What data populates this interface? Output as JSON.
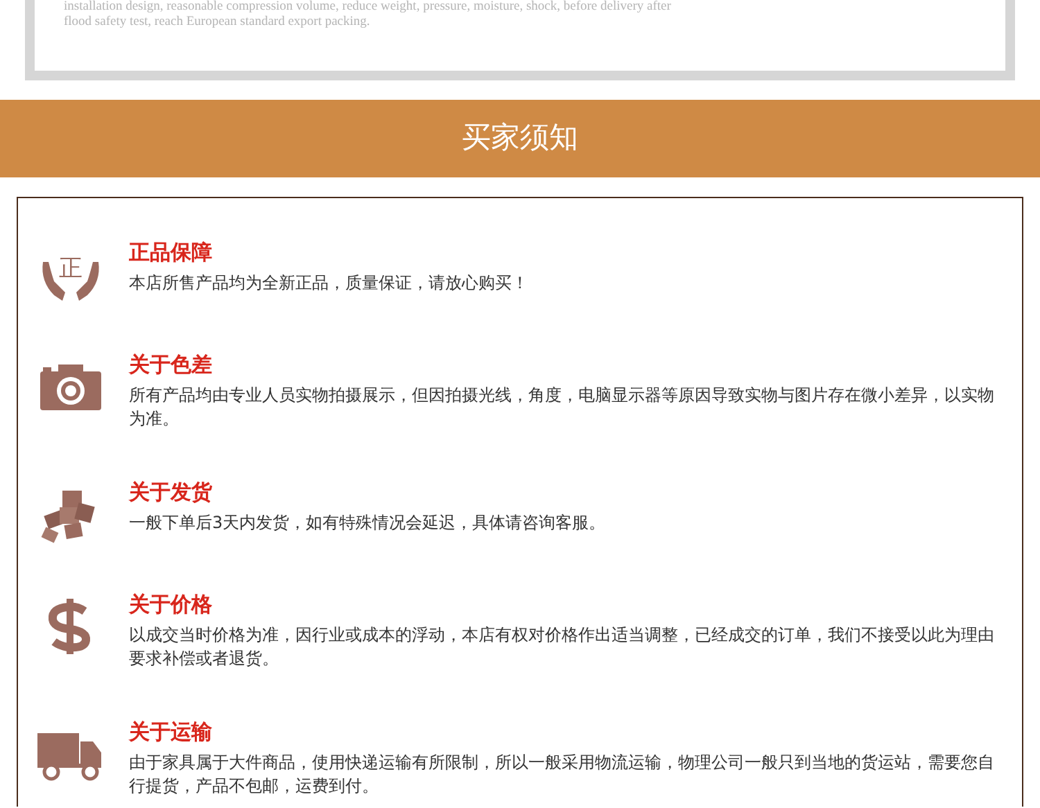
{
  "intro_card": {
    "lines": [
      "installation design, reasonable compression volume, reduce weight, pressure, moisture, shock, before delivery after",
      "flood safety test, reach European standard export packing."
    ]
  },
  "banner": {
    "title": "买家须知"
  },
  "notices": [
    {
      "kind": "genuine",
      "icon_label": "正",
      "title": "正品保障",
      "text": "本店所售产品均为全新正品，质量保证，请放心购买！"
    },
    {
      "kind": "camera",
      "title": "关于色差",
      "text": "所有产品均由专业人员实物拍摄展示，但因拍摄光线，角度，电脑显示器等原因导致实物与图片存在微小差异，以实物为准。"
    },
    {
      "kind": "boxes",
      "title": "关于发货",
      "text": "一般下单后3天内发货，如有特殊情况会延迟，具体请咨询客服。"
    },
    {
      "kind": "price",
      "title": "关于价格",
      "text": "以成交当时价格为准，因行业或成本的浮动，本店有权对价格作出适当调整，已经成交的订单，我们不接受以此为理由要求补偿或者退货。"
    },
    {
      "kind": "truck",
      "title": "关于运输",
      "text": "由于家具属于大件商品，使用快递运输有所限制，所以一般采用物流运输，物理公司一般只到当地的货运站，需要您自行提货，产品不包邮，运费到付。"
    }
  ]
}
